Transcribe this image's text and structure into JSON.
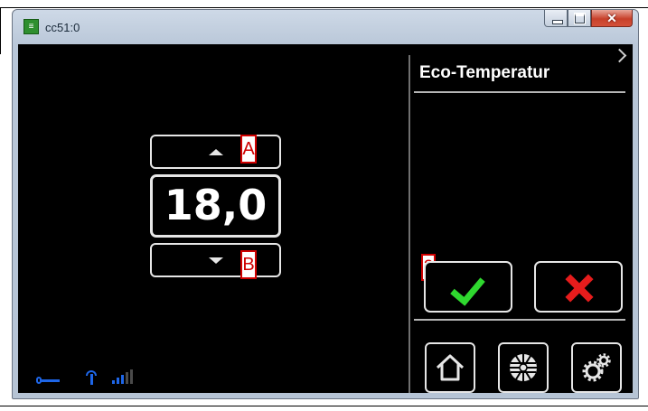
{
  "window": {
    "title": "cc51:0",
    "app_icon_glyph": "≡",
    "controls": {
      "minimize_icon": "minimize-icon",
      "maximize_icon": "maximize-icon",
      "close_glyph": "✕"
    }
  },
  "setpoint": {
    "value": "18,0",
    "increase_icon": "triangle-up-icon",
    "decrease_icon": "triangle-down-icon"
  },
  "annotations": {
    "a": "A",
    "b": "B",
    "n2": "2"
  },
  "panel": {
    "title": "Eco-Temperatur",
    "next_icon": "chevron-right-icon",
    "confirm_icon": "checkmark-icon",
    "cancel_icon": "x-icon"
  },
  "nav": {
    "home_icon": "home-icon",
    "fan_icon": "fan-icon",
    "settings_icon": "gears-icon"
  },
  "status": {
    "icons": [
      "wrench-icon",
      "antenna-icon",
      "signal-strength-icon"
    ],
    "signal_level": 3,
    "signal_max": 5
  },
  "colors": {
    "background": "#000000",
    "button_border": "#e6e6e6",
    "confirm": "#2fd82f",
    "cancel": "#e61c1c",
    "status_blue": "#1e66e8",
    "annotation_red": "#d00000"
  }
}
